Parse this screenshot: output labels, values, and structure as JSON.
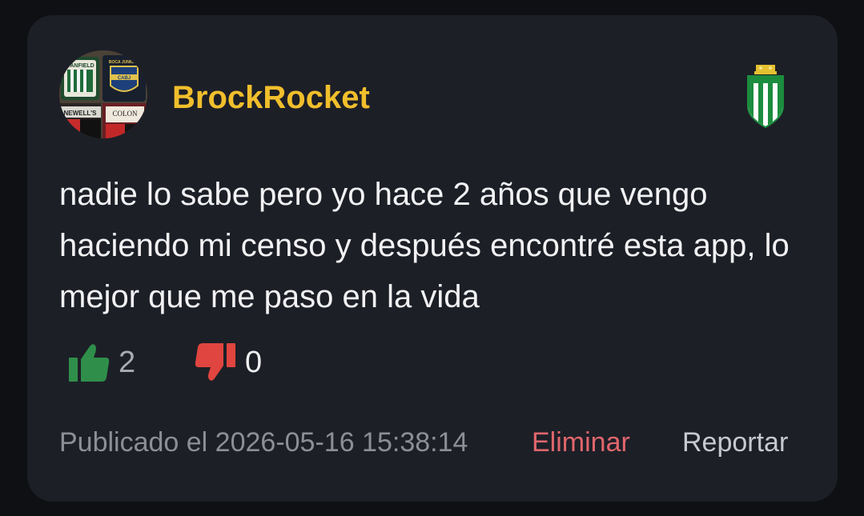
{
  "post": {
    "username": "BrockRocket",
    "avatar": {
      "icon": "club-stickers-avatar",
      "texts": [
        "BANFIELD",
        "BOCA JUNIORS",
        "NEWELL'S",
        "COLON"
      ]
    },
    "team_badge_icon": "banfield-shield-icon",
    "text": "nadie lo sabe pero yo hace 2 años que vengo haciendo mi censo y después encontré esta app, lo mejor que me paso en la vida",
    "likes": "2",
    "dislikes": "0",
    "timestamp": "Publicado el 2026-05-16 15:38:14",
    "delete_label": "Eliminar",
    "report_label": "Reportar"
  },
  "colors": {
    "background": "#0f1013",
    "card": "#1d1f27",
    "username": "#f1bf2c",
    "like": "#2f8f4a",
    "dislike": "#e0453f",
    "delete": "#e0666c"
  }
}
